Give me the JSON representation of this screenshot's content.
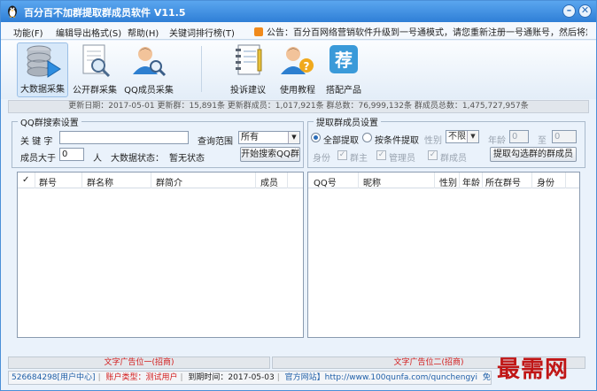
{
  "window": {
    "title": "百分百不加群提取群成员软件 V11.5",
    "minimize": "–",
    "close": "✕"
  },
  "menu": {
    "items": [
      "功能(F)",
      "编辑导出格式(S)",
      "帮助(H)",
      "关键词排行榜(T)"
    ],
    "notice": "公告：百分百网络营销软件升级到一号通模式，请您重新注册一号通账号，然后将您的"
  },
  "toolbar": {
    "buttons": [
      {
        "label": "大数据采集",
        "icon": "database-icon"
      },
      {
        "label": "公开群采集",
        "icon": "document-search-icon"
      },
      {
        "label": "QQ成员采集",
        "icon": "user-search-icon"
      },
      {
        "label": "投诉建议",
        "icon": "notebook-icon"
      },
      {
        "label": "使用教程",
        "icon": "help-user-icon"
      },
      {
        "label": "搭配产品",
        "icon": "recommend-icon",
        "glyph": "荐"
      }
    ]
  },
  "update_info": "更新日期：2017-05-01 更新群：15,891条 更新群成员：1,017,921条 群总数：76,999,132条 群成员总数：1,475,727,957条",
  "qq_search": {
    "legend": "QQ群搜索设置",
    "keyword_label": "关 键 字",
    "keyword_value": "",
    "range_label": "查询范围",
    "range_value": "所有",
    "members_gt_label": "成员大于",
    "members_gt_value": "0",
    "members_unit": "人",
    "status_label": "大数据状态：",
    "status_value": "暂无状态",
    "start_button": "开始搜索QQ群"
  },
  "extract": {
    "legend": "提取群成员设置",
    "radio_all": "全部提取",
    "radio_cond": "按条件提取",
    "gender_label": "性别",
    "gender_value": "不限",
    "age_label": "年龄",
    "age_from": "0",
    "age_to_label": "至",
    "age_to": "0",
    "identity_label": "身份",
    "opt_owner": "群主",
    "opt_admin": "管理员",
    "opt_member": "群成员",
    "extract_button": "提取勾选群的群成员"
  },
  "left_table": {
    "columns": [
      "✓",
      "群号",
      "群名称",
      "群简介",
      "成员"
    ],
    "rows": []
  },
  "right_table": {
    "columns": [
      "QQ号",
      "昵称",
      "性别",
      "年龄",
      "所在群号",
      "身份"
    ],
    "rows": []
  },
  "ads": {
    "ad1": "文字广告位一(招商)",
    "ad2": "文字广告位二(招商)"
  },
  "status": {
    "account": "526684298[用户中心]",
    "user_type": "账户类型：测试用户",
    "expiry": "到期时间：2017-05-03",
    "website": "官方网站】http://www.100qunfa.com/qunchengyi",
    "disclaimer": "免责声明"
  },
  "watermark": "最需网",
  "colors": {
    "title_bar": "#2f7fd6",
    "accent": "#2a6cb8",
    "ad_text": "#d21b1b",
    "watermark": "#c01616"
  }
}
